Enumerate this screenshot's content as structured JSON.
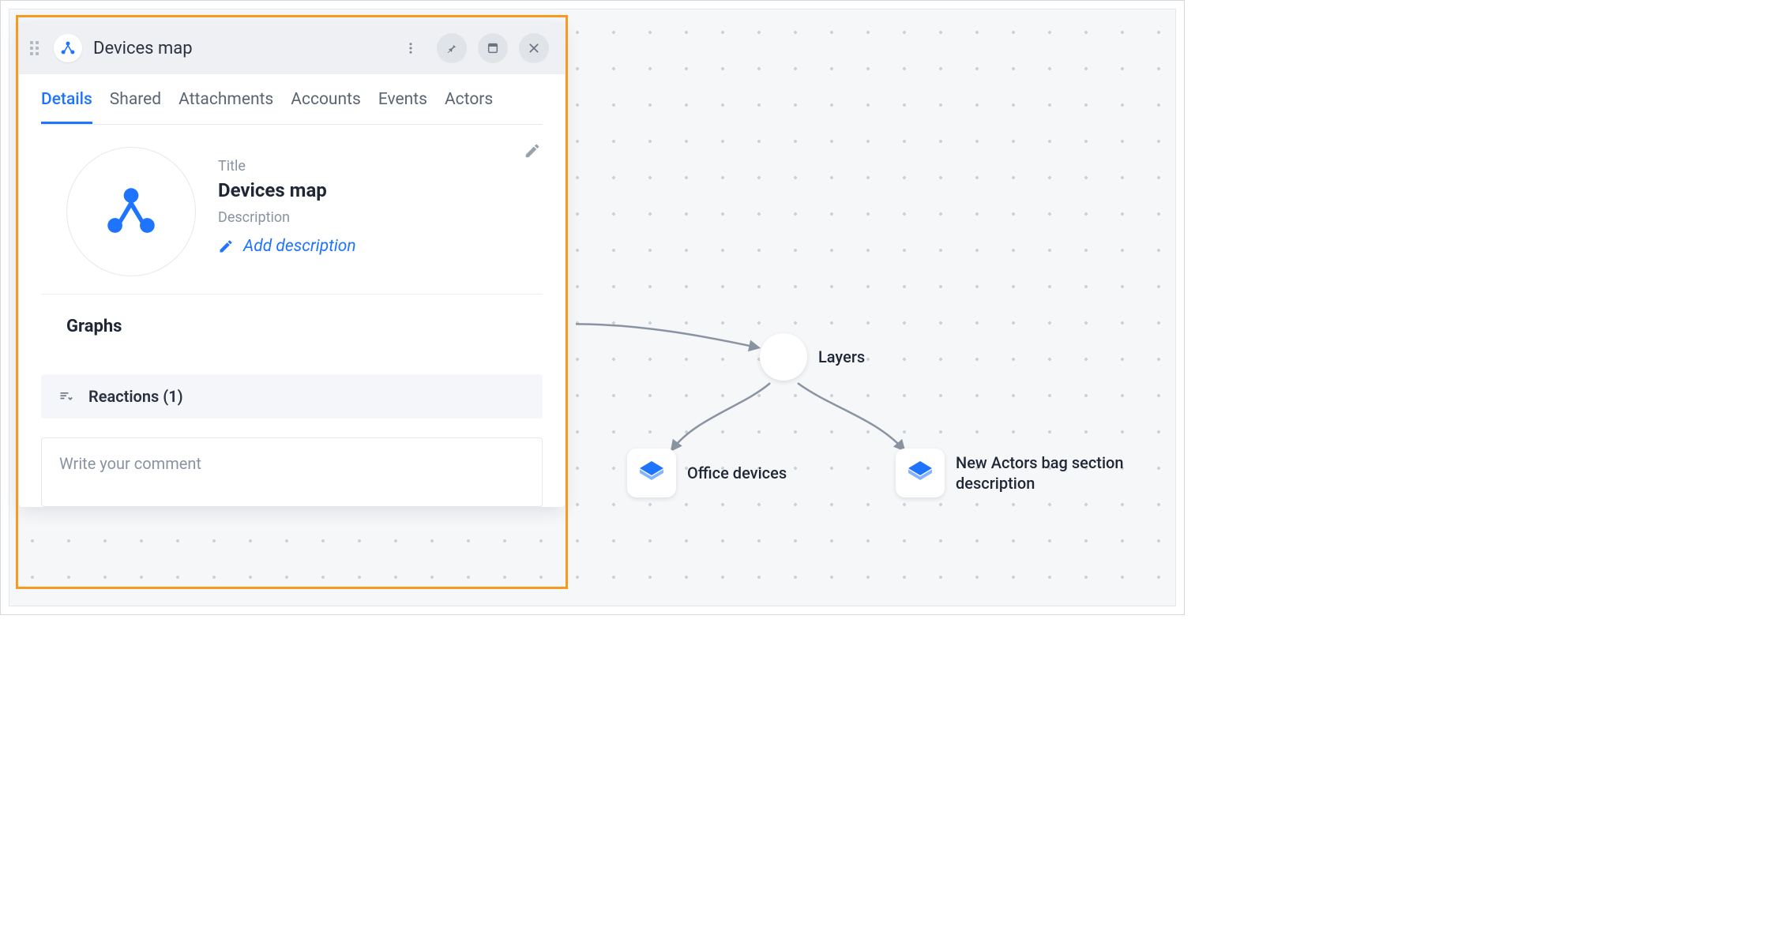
{
  "panel": {
    "header_title": "Devices map",
    "tabs": [
      "Details",
      "Shared",
      "Attachments",
      "Accounts",
      "Events",
      "Actors"
    ],
    "active_tab": 0,
    "title_label": "Title",
    "title_value": "Devices map",
    "description_label": "Description",
    "add_description": "Add description",
    "graphs_heading": "Graphs",
    "reactions_label": "Reactions (1)",
    "comment_placeholder": "Write your comment"
  },
  "canvas": {
    "nodes": {
      "layers": {
        "label": "Layers"
      },
      "office": {
        "label": "Office devices"
      },
      "newact": {
        "label": "New Actors bag section description"
      }
    }
  },
  "colors": {
    "accent": "#1f74ff",
    "highlight_border": "#f59b22"
  }
}
